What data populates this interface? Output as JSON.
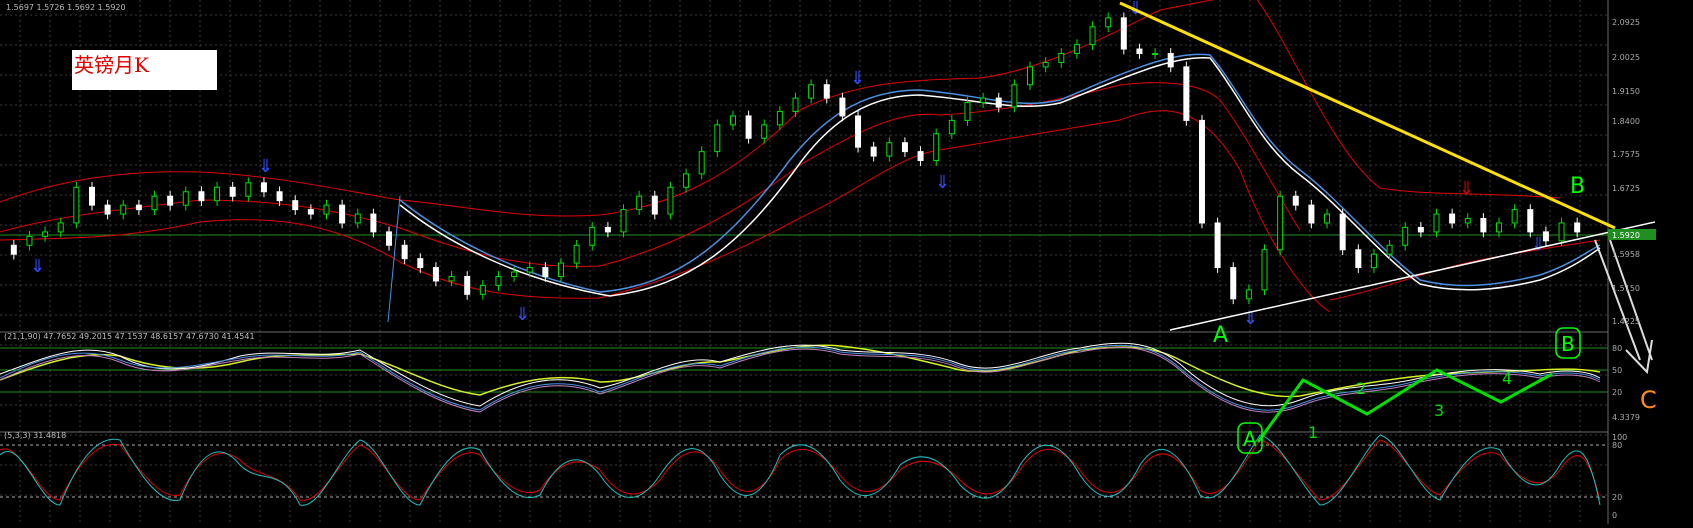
{
  "header": {
    "ohlc_text": "1.5697 1.5726 1.5692 1.5920",
    "indicator1_text": "(21,1,90)  47.7652  49.2015  47.1537  48.6157  47.6730  41.4541",
    "indicator2_text": "(5,3,3)  31.4818"
  },
  "title_label": "英镑月K",
  "annotations": {
    "A_main": "A",
    "B_main": "B",
    "C_main": "C",
    "A_circled": "A",
    "B_circled": "B",
    "wave_1": "1",
    "wave_2": "2",
    "wave_3": "3",
    "wave_4": "4"
  },
  "price_axis": {
    "labels": [
      "2.0925",
      "2.0025",
      "1.9150",
      "1.8400",
      "1.7575",
      "1.6725",
      "1.5958",
      "1.5150",
      "1.4225"
    ],
    "current_label": "1.5920"
  },
  "indicator1_axis": {
    "labels": [
      "80",
      "50",
      "20",
      "4.3379"
    ]
  },
  "indicator2_axis": {
    "labels": [
      "100",
      "80",
      "20",
      "0"
    ]
  },
  "colors": {
    "background": "#000000",
    "grid": "#3a3a3a",
    "bull_candle": "#00e000",
    "bear_candle": "#ffffff",
    "bollinger": "#e00000",
    "ma_white": "#ffffff",
    "ma_blue": "#4a90e2",
    "trendline_yellow": "#ffe000",
    "trendline_white": "#ffffff",
    "annotation_green": "#00ff00",
    "annotation_orange": "#ff8c1a",
    "fractal_blue": "#3050ff",
    "stoch_red": "#e00000",
    "stoch_cyan": "#20c0c0"
  },
  "chart_data": {
    "type": "candlestick",
    "title": "英镑月K",
    "y_range": [
      1.38,
      2.12
    ],
    "candles_close_path": [
      [
        1.57,
        1.55
      ],
      [
        1.57,
        1.59
      ],
      [
        1.59,
        1.6
      ],
      [
        1.6,
        1.62
      ],
      [
        1.62,
        1.7
      ],
      [
        1.7,
        1.66
      ],
      [
        1.66,
        1.64
      ],
      [
        1.64,
        1.66
      ],
      [
        1.66,
        1.65
      ],
      [
        1.65,
        1.68
      ],
      [
        1.68,
        1.66
      ],
      [
        1.66,
        1.69
      ],
      [
        1.69,
        1.67
      ],
      [
        1.67,
        1.7
      ],
      [
        1.7,
        1.68
      ],
      [
        1.68,
        1.71
      ],
      [
        1.71,
        1.69
      ],
      [
        1.69,
        1.67
      ],
      [
        1.67,
        1.65
      ],
      [
        1.65,
        1.64
      ],
      [
        1.64,
        1.66
      ],
      [
        1.66,
        1.62
      ],
      [
        1.62,
        1.64
      ],
      [
        1.64,
        1.6
      ],
      [
        1.6,
        1.57
      ],
      [
        1.57,
        1.54
      ],
      [
        1.54,
        1.52
      ],
      [
        1.52,
        1.49
      ],
      [
        1.49,
        1.5
      ],
      [
        1.5,
        1.46
      ],
      [
        1.46,
        1.48
      ],
      [
        1.48,
        1.5
      ],
      [
        1.5,
        1.51
      ],
      [
        1.51,
        1.52
      ],
      [
        1.52,
        1.5
      ],
      [
        1.5,
        1.53
      ],
      [
        1.53,
        1.57
      ],
      [
        1.57,
        1.61
      ],
      [
        1.61,
        1.6
      ],
      [
        1.6,
        1.65
      ],
      [
        1.65,
        1.68
      ],
      [
        1.68,
        1.64
      ],
      [
        1.64,
        1.7
      ],
      [
        1.7,
        1.73
      ],
      [
        1.73,
        1.78
      ],
      [
        1.78,
        1.84
      ],
      [
        1.84,
        1.86
      ],
      [
        1.86,
        1.81
      ],
      [
        1.81,
        1.84
      ],
      [
        1.84,
        1.87
      ],
      [
        1.87,
        1.9
      ],
      [
        1.9,
        1.93
      ],
      [
        1.93,
        1.9
      ],
      [
        1.9,
        1.86
      ],
      [
        1.86,
        1.79
      ],
      [
        1.79,
        1.77
      ],
      [
        1.77,
        1.8
      ],
      [
        1.8,
        1.78
      ],
      [
        1.78,
        1.76
      ],
      [
        1.76,
        1.82
      ],
      [
        1.82,
        1.85
      ],
      [
        1.85,
        1.89
      ],
      [
        1.89,
        1.9
      ],
      [
        1.9,
        1.88
      ],
      [
        1.88,
        1.93
      ],
      [
        1.93,
        1.97
      ],
      [
        1.97,
        1.98
      ],
      [
        1.98,
        2.0
      ],
      [
        2.0,
        2.02
      ],
      [
        2.02,
        2.06
      ],
      [
        2.06,
        2.08
      ],
      [
        2.08,
        2.01
      ],
      [
        2.01,
        2.0
      ],
      [
        2.0,
        2.0
      ],
      [
        2.0,
        1.97
      ],
      [
        1.97,
        1.85
      ],
      [
        1.85,
        1.62
      ],
      [
        1.62,
        1.52
      ],
      [
        1.52,
        1.45
      ],
      [
        1.45,
        1.47
      ],
      [
        1.47,
        1.56
      ],
      [
        1.56,
        1.68
      ],
      [
        1.68,
        1.66
      ],
      [
        1.66,
        1.62
      ],
      [
        1.62,
        1.64
      ],
      [
        1.64,
        1.56
      ],
      [
        1.56,
        1.52
      ],
      [
        1.52,
        1.55
      ],
      [
        1.55,
        1.57
      ],
      [
        1.57,
        1.61
      ],
      [
        1.61,
        1.6
      ],
      [
        1.6,
        1.64
      ],
      [
        1.64,
        1.62
      ],
      [
        1.62,
        1.63
      ],
      [
        1.63,
        1.6
      ],
      [
        1.6,
        1.62
      ],
      [
        1.62,
        1.65
      ],
      [
        1.65,
        1.6
      ],
      [
        1.6,
        1.58
      ],
      [
        1.58,
        1.62
      ],
      [
        1.62,
        1.6
      ]
    ]
  }
}
